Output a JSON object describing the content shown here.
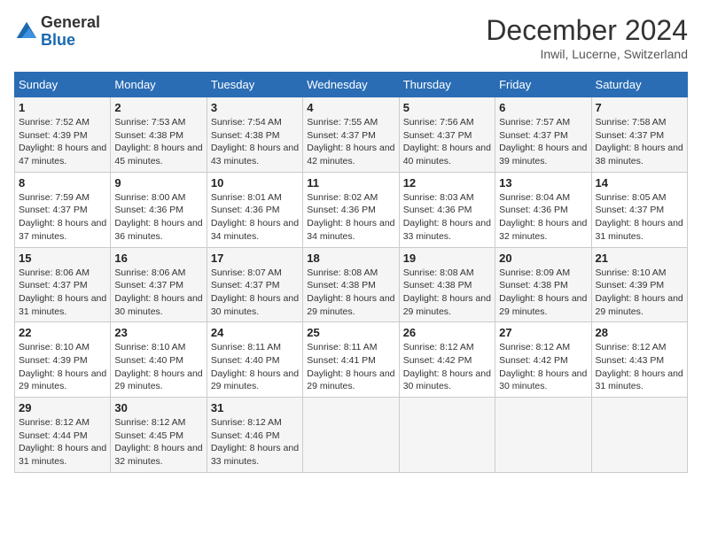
{
  "header": {
    "logo_general": "General",
    "logo_blue": "Blue",
    "month_title": "December 2024",
    "subtitle": "Inwil, Lucerne, Switzerland"
  },
  "calendar": {
    "day_headers": [
      "Sunday",
      "Monday",
      "Tuesday",
      "Wednesday",
      "Thursday",
      "Friday",
      "Saturday"
    ],
    "weeks": [
      [
        {
          "day": "1",
          "sunrise": "7:52 AM",
          "sunset": "4:39 PM",
          "daylight": "8 hours and 47 minutes."
        },
        {
          "day": "2",
          "sunrise": "7:53 AM",
          "sunset": "4:38 PM",
          "daylight": "8 hours and 45 minutes."
        },
        {
          "day": "3",
          "sunrise": "7:54 AM",
          "sunset": "4:38 PM",
          "daylight": "8 hours and 43 minutes."
        },
        {
          "day": "4",
          "sunrise": "7:55 AM",
          "sunset": "4:37 PM",
          "daylight": "8 hours and 42 minutes."
        },
        {
          "day": "5",
          "sunrise": "7:56 AM",
          "sunset": "4:37 PM",
          "daylight": "8 hours and 40 minutes."
        },
        {
          "day": "6",
          "sunrise": "7:57 AM",
          "sunset": "4:37 PM",
          "daylight": "8 hours and 39 minutes."
        },
        {
          "day": "7",
          "sunrise": "7:58 AM",
          "sunset": "4:37 PM",
          "daylight": "8 hours and 38 minutes."
        }
      ],
      [
        {
          "day": "8",
          "sunrise": "7:59 AM",
          "sunset": "4:37 PM",
          "daylight": "8 hours and 37 minutes."
        },
        {
          "day": "9",
          "sunrise": "8:00 AM",
          "sunset": "4:36 PM",
          "daylight": "8 hours and 36 minutes."
        },
        {
          "day": "10",
          "sunrise": "8:01 AM",
          "sunset": "4:36 PM",
          "daylight": "8 hours and 34 minutes."
        },
        {
          "day": "11",
          "sunrise": "8:02 AM",
          "sunset": "4:36 PM",
          "daylight": "8 hours and 34 minutes."
        },
        {
          "day": "12",
          "sunrise": "8:03 AM",
          "sunset": "4:36 PM",
          "daylight": "8 hours and 33 minutes."
        },
        {
          "day": "13",
          "sunrise": "8:04 AM",
          "sunset": "4:36 PM",
          "daylight": "8 hours and 32 minutes."
        },
        {
          "day": "14",
          "sunrise": "8:05 AM",
          "sunset": "4:37 PM",
          "daylight": "8 hours and 31 minutes."
        }
      ],
      [
        {
          "day": "15",
          "sunrise": "8:06 AM",
          "sunset": "4:37 PM",
          "daylight": "8 hours and 31 minutes."
        },
        {
          "day": "16",
          "sunrise": "8:06 AM",
          "sunset": "4:37 PM",
          "daylight": "8 hours and 30 minutes."
        },
        {
          "day": "17",
          "sunrise": "8:07 AM",
          "sunset": "4:37 PM",
          "daylight": "8 hours and 30 minutes."
        },
        {
          "day": "18",
          "sunrise": "8:08 AM",
          "sunset": "4:38 PM",
          "daylight": "8 hours and 29 minutes."
        },
        {
          "day": "19",
          "sunrise": "8:08 AM",
          "sunset": "4:38 PM",
          "daylight": "8 hours and 29 minutes."
        },
        {
          "day": "20",
          "sunrise": "8:09 AM",
          "sunset": "4:38 PM",
          "daylight": "8 hours and 29 minutes."
        },
        {
          "day": "21",
          "sunrise": "8:10 AM",
          "sunset": "4:39 PM",
          "daylight": "8 hours and 29 minutes."
        }
      ],
      [
        {
          "day": "22",
          "sunrise": "8:10 AM",
          "sunset": "4:39 PM",
          "daylight": "8 hours and 29 minutes."
        },
        {
          "day": "23",
          "sunrise": "8:10 AM",
          "sunset": "4:40 PM",
          "daylight": "8 hours and 29 minutes."
        },
        {
          "day": "24",
          "sunrise": "8:11 AM",
          "sunset": "4:40 PM",
          "daylight": "8 hours and 29 minutes."
        },
        {
          "day": "25",
          "sunrise": "8:11 AM",
          "sunset": "4:41 PM",
          "daylight": "8 hours and 29 minutes."
        },
        {
          "day": "26",
          "sunrise": "8:12 AM",
          "sunset": "4:42 PM",
          "daylight": "8 hours and 30 minutes."
        },
        {
          "day": "27",
          "sunrise": "8:12 AM",
          "sunset": "4:42 PM",
          "daylight": "8 hours and 30 minutes."
        },
        {
          "day": "28",
          "sunrise": "8:12 AM",
          "sunset": "4:43 PM",
          "daylight": "8 hours and 31 minutes."
        }
      ],
      [
        {
          "day": "29",
          "sunrise": "8:12 AM",
          "sunset": "4:44 PM",
          "daylight": "8 hours and 31 minutes."
        },
        {
          "day": "30",
          "sunrise": "8:12 AM",
          "sunset": "4:45 PM",
          "daylight": "8 hours and 32 minutes."
        },
        {
          "day": "31",
          "sunrise": "8:12 AM",
          "sunset": "4:46 PM",
          "daylight": "8 hours and 33 minutes."
        },
        null,
        null,
        null,
        null
      ]
    ]
  }
}
